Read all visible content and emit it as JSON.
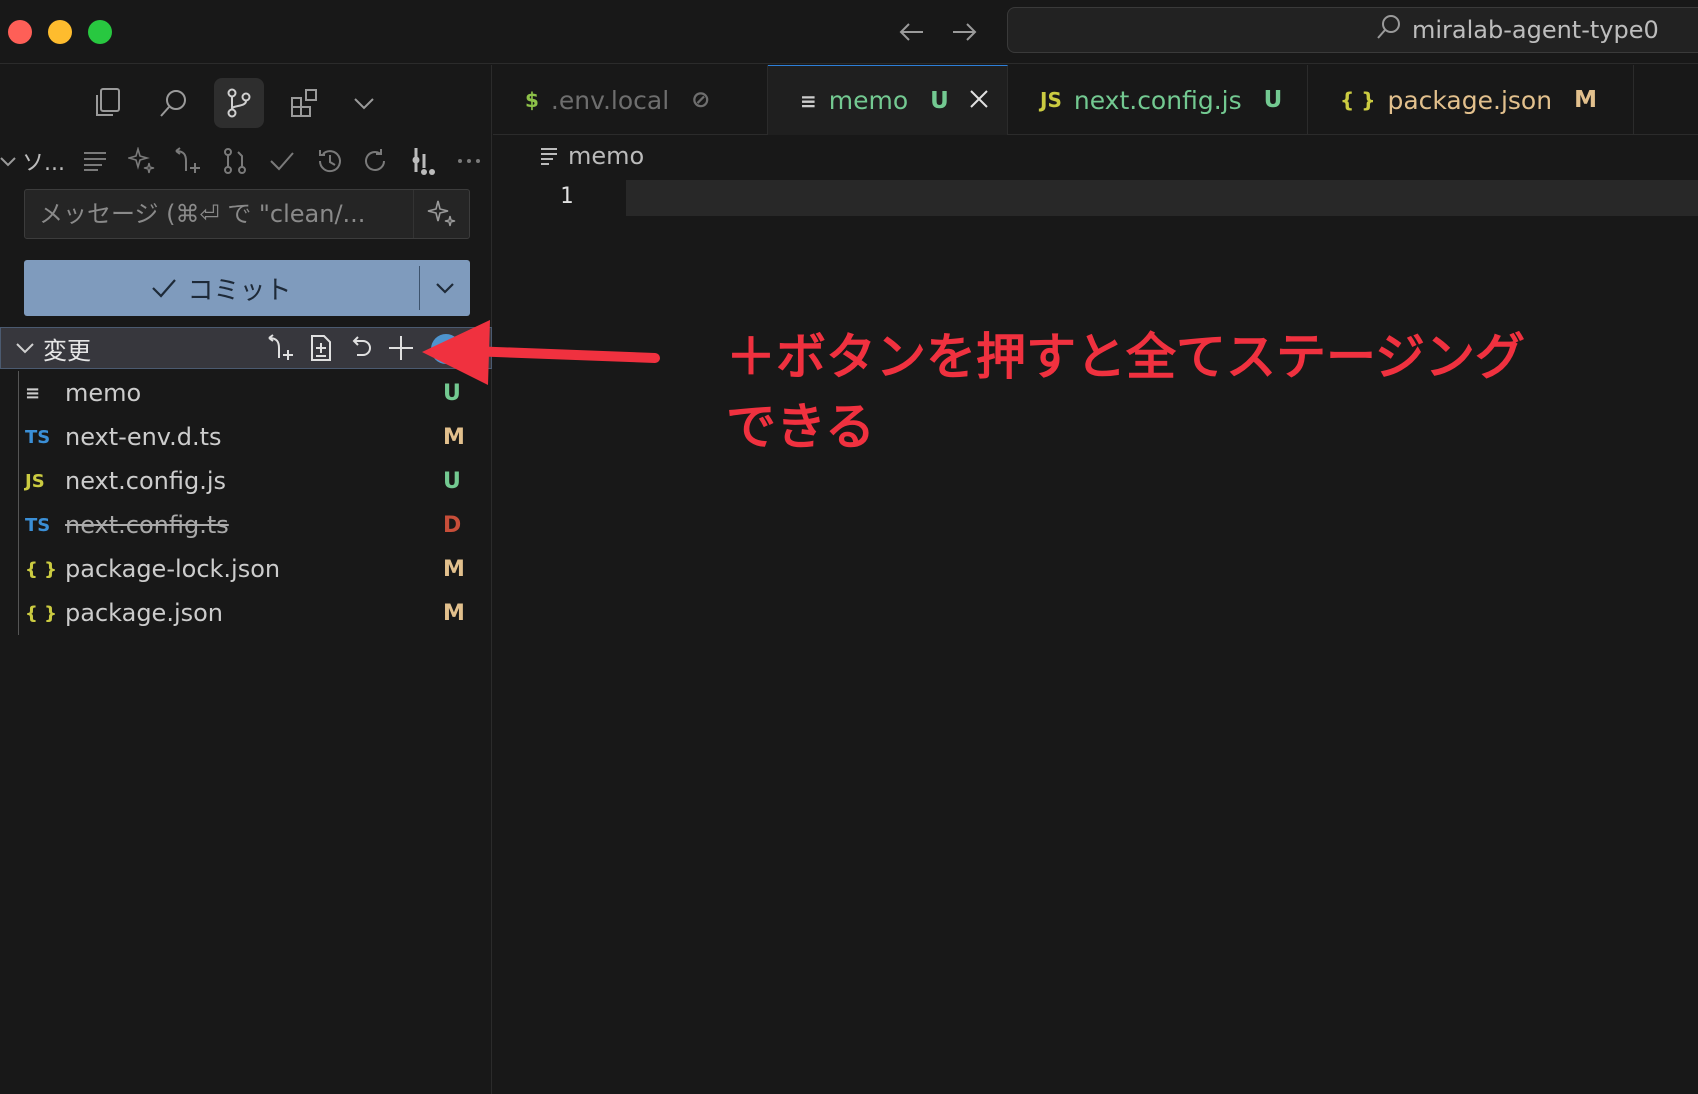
{
  "titlebar": {
    "search_text": "miralab-agent-type0"
  },
  "scm": {
    "title": "ソ...",
    "message_placeholder": "メッセージ (⌘⏎ で \"clean/...",
    "commit_label": "コミット",
    "changes_label": "変更",
    "files": [
      {
        "icon": "≡",
        "icon_color": "#cccccc",
        "name": "memo",
        "status": "U",
        "status_color": "#73c991",
        "deleted": false
      },
      {
        "icon": "TS",
        "icon_color": "#3b8fd6",
        "name": "next-env.d.ts",
        "status": "M",
        "status_color": "#e2c08d",
        "deleted": false
      },
      {
        "icon": "JS",
        "icon_color": "#cbcb41",
        "name": "next.config.js",
        "status": "U",
        "status_color": "#73c991",
        "deleted": false
      },
      {
        "icon": "TS",
        "icon_color": "#3b8fd6",
        "name": "next.config.ts",
        "status": "D",
        "status_color": "#c74e39",
        "deleted": true
      },
      {
        "icon": "{ }",
        "icon_color": "#cbcb41",
        "name": "package-lock.json",
        "status": "M",
        "status_color": "#e2c08d",
        "deleted": false
      },
      {
        "icon": "{ }",
        "icon_color": "#cbcb41",
        "name": "package.json",
        "status": "M",
        "status_color": "#e2c08d",
        "deleted": false
      }
    ]
  },
  "tabs": [
    {
      "icon": "$",
      "icon_color": "#8dc149",
      "label": ".env.local",
      "badge": "⊘",
      "label_color": "#6e6e6e",
      "badge_color": "#6e6e6e",
      "active": false
    },
    {
      "icon": "≡",
      "icon_color": "#cccccc",
      "label": "memo",
      "badge": "U",
      "label_color": "#73c991",
      "badge_color": "#73c991",
      "active": true
    },
    {
      "icon": "JS",
      "icon_color": "#cbcb41",
      "label": "next.config.js",
      "badge": "U",
      "label_color": "#73c991",
      "badge_color": "#73c991",
      "active": false
    },
    {
      "icon": "{ }",
      "icon_color": "#cbcb41",
      "label": "package.json",
      "badge": "M",
      "label_color": "#e2c08d",
      "badge_color": "#e2c08d",
      "active": false
    }
  ],
  "editor": {
    "breadcrumb": "memo",
    "line_number": "1"
  },
  "annotation": {
    "line1": "＋ボタンを押すと全てステージング",
    "line2": "できる",
    "color": "#f0313f"
  },
  "colors": {
    "commit_button": "#7f9bbd",
    "accent": "#2d7fd8"
  }
}
